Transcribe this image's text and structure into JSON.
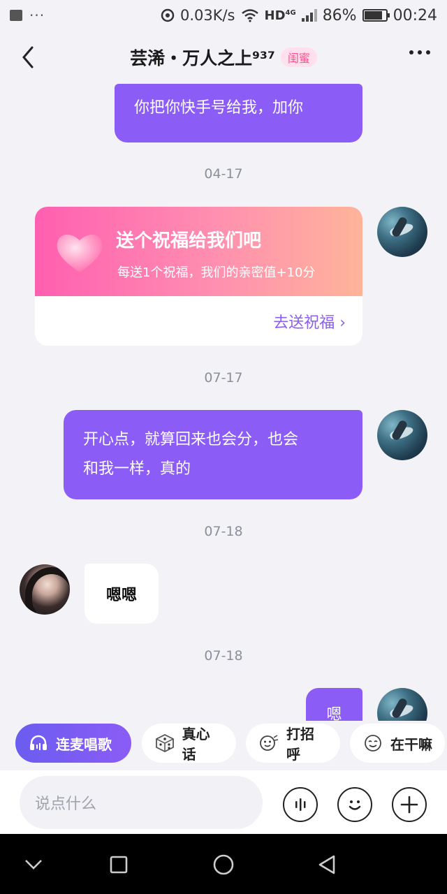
{
  "status_bar": {
    "net_speed": "0.03K/s",
    "network_type": "HD",
    "network_gen": "4G",
    "battery": "86%",
    "time": "00:24"
  },
  "header": {
    "title": "芸浠・万人之上⁹³⁷",
    "badge": "闺蜜"
  },
  "messages": [
    {
      "type": "text",
      "from": "me",
      "text": "你把你快手号给我，加你"
    },
    {
      "type": "date",
      "text": "04-17"
    },
    {
      "type": "card",
      "from": "me",
      "title": "送个祝福给我们吧",
      "subtitle": "每送1个祝福，我们的亲密值+10分",
      "action": "去送祝福 ›"
    },
    {
      "type": "date",
      "text": "07-17"
    },
    {
      "type": "text",
      "from": "me",
      "lines": [
        "开心点，就算回来也会分，也会",
        "和我一样，真的"
      ]
    },
    {
      "type": "date",
      "text": "07-18"
    },
    {
      "type": "text",
      "from": "other",
      "text": "嗯嗯"
    },
    {
      "type": "date",
      "text": "07-18"
    },
    {
      "type": "text",
      "from": "me",
      "text": "嗯"
    }
  ],
  "quick_replies": [
    {
      "label": "连麦唱歌",
      "icon": "headphones-icon",
      "primary": true
    },
    {
      "label": "真心话",
      "icon": "dice-icon"
    },
    {
      "label": "打招呼",
      "icon": "wave-emoji-icon"
    },
    {
      "label": "在干嘛",
      "icon": "smile-emoji-icon"
    }
  ],
  "input": {
    "placeholder": "说点什么"
  },
  "colors": {
    "accent": "#8b5cf6",
    "background": "#f2f2f7",
    "badge_text": "#ff4f8f",
    "card_gradient_start": "#ff5fb0",
    "card_gradient_end": "#ffb49a"
  }
}
